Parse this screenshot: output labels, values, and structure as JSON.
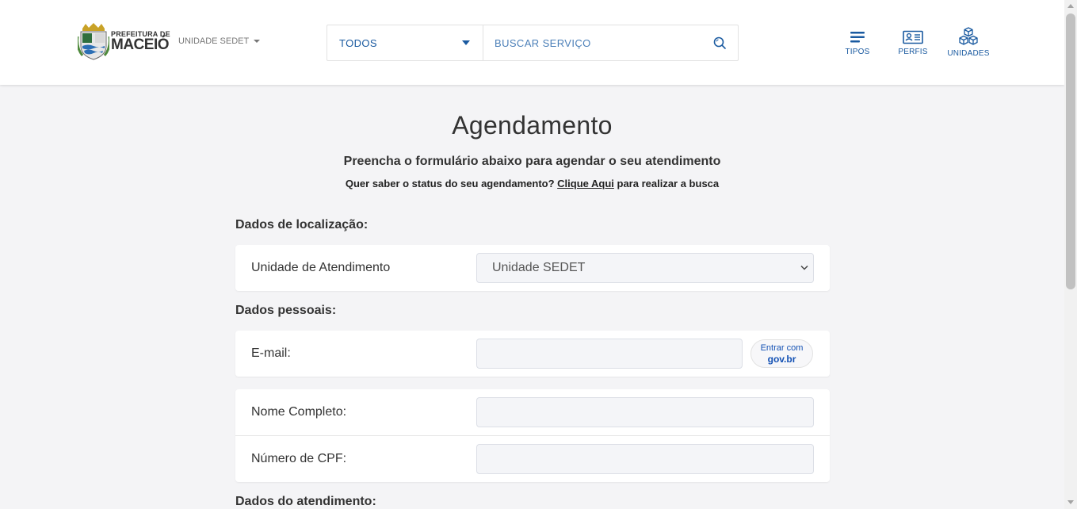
{
  "header": {
    "logo": {
      "line1": "PREFEITURA DE",
      "line2": "MACEIÓ"
    },
    "unit_selector": "UNIDADE SEDET",
    "search": {
      "category": "TODOS",
      "placeholder": "BUSCAR SERVIÇO"
    },
    "nav": [
      {
        "label": "TIPOS",
        "icon": "list-icon"
      },
      {
        "label": "PERFIS",
        "icon": "id-card-icon"
      },
      {
        "label": "UNIDADES",
        "icon": "cubes-icon"
      }
    ]
  },
  "main": {
    "title": "Agendamento",
    "subtitle": "Preencha o formulário abaixo para agendar o seu atendimento",
    "status": {
      "prefix": "Quer saber o status do seu agendamento? ",
      "link": "Clique Aqui",
      "suffix": " para realizar a busca"
    },
    "sections": {
      "location": "Dados de localização:",
      "personal": "Dados pessoais:",
      "service": "Dados do atendimento:"
    },
    "fields": {
      "unit": {
        "label": "Unidade de Atendimento",
        "value": "Unidade SEDET"
      },
      "email": {
        "label": "E-mail:",
        "value": ""
      },
      "name": {
        "label": "Nome Completo:",
        "value": ""
      },
      "cpf": {
        "label": "Número de CPF:",
        "value": ""
      }
    },
    "govbr": {
      "line1": "Entrar com",
      "line2": "gov.br"
    }
  },
  "colors": {
    "accent": "#1a5aa0",
    "background": "#f4f4f6",
    "govbr": "#1351b4"
  }
}
